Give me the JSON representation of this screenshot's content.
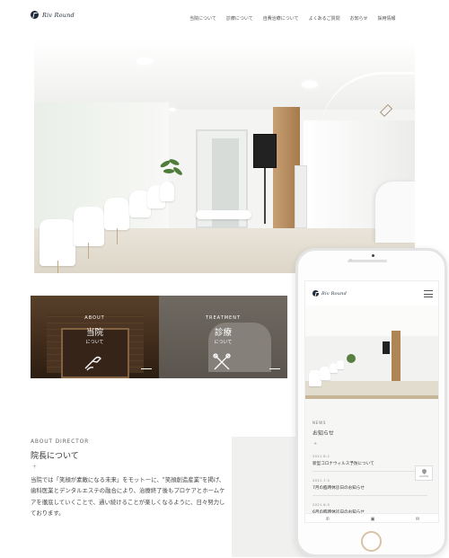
{
  "site": {
    "logo_text": "Riv Round"
  },
  "nav": {
    "items": [
      "当院について",
      "診療について",
      "自費治療について",
      "よくあるご質問",
      "お知らせ",
      "採用情報"
    ]
  },
  "hero": {
    "alt": "clinic-interior-photo"
  },
  "cards": [
    {
      "en": "ABOUT",
      "jp": "当院",
      "sub": "について",
      "icon": "tooth-tool-icon"
    },
    {
      "en": "TREATMENT",
      "jp": "診療",
      "sub": "について",
      "icon": "dental-tools-icon"
    }
  ],
  "about": {
    "en": "ABOUT DIRECTOR",
    "jp": "院長について",
    "plus": "+",
    "text": "当院では「笑顔が素敵になる未来」をモットーに、\"笑顔創造産業\"を掲げ、歯科医業とデンタルエステの融合により、治療終了後もプロケアとホームケアを徹底していくことで、通い続けることが楽しくなるように、日々努力しております。"
  },
  "phone": {
    "logo_text": "Riv Round",
    "news": {
      "en": "NEWS",
      "jp": "お知らせ",
      "plus": "+",
      "items": [
        {
          "date": "2021.8.2",
          "title": "新型コロナウィルス予防について"
        },
        {
          "date": "2021.7.5",
          "title": "7月の臨時休診日のお知らせ"
        },
        {
          "date": "2021.6.5",
          "title": "6月の臨時休診日のお知らせ"
        }
      ]
    },
    "access_label": "ACCESS"
  },
  "colors": {
    "brand_navy": "#1f2a3c",
    "gold": "#c7a075"
  }
}
